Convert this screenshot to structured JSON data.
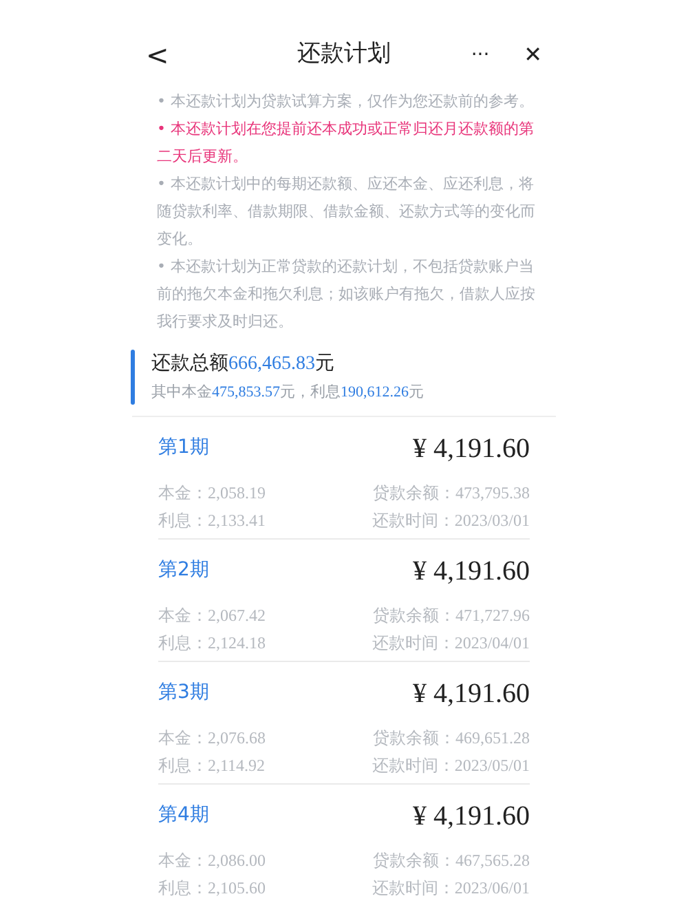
{
  "header": {
    "back": "<",
    "title": "还款计划",
    "more": "···",
    "close": "✕"
  },
  "notes": [
    {
      "text": "• 本还款计划为贷款试算方案，仅作为您还款前的参考。",
      "kind": "normal"
    },
    {
      "text": "• 本还款计划在您提前还本成功或正常归还月还款额的第二天后更新。",
      "kind": "highlight"
    },
    {
      "text": "• 本还款计划中的每期还款额、应还本金、应还利息，将随贷款利率、借款期限、借款金额、还款方式等的变化而变化。",
      "kind": "normal"
    },
    {
      "text": "• 本还款计划为正常贷款的还款计划，不包括贷款账户当前的拖欠本金和拖欠利息；如该账户有拖欠，借款人应按我行要求及时归还。",
      "kind": "normal"
    }
  ],
  "summary": {
    "total": [
      {
        "text": "还款总额",
        "kind": "label"
      },
      {
        "text": "666,465.83",
        "kind": "number"
      },
      {
        "text": "元",
        "kind": "label"
      }
    ],
    "breakdown": [
      {
        "text": "其中本金",
        "kind": "label"
      },
      {
        "text": "475,853.57",
        "kind": "number"
      },
      {
        "text": "元，利息",
        "kind": "label"
      },
      {
        "text": "190,612.26",
        "kind": "number"
      },
      {
        "text": "元",
        "kind": "label"
      }
    ]
  },
  "periods": [
    {
      "name": "第1期",
      "amount": "¥ 4,191.60",
      "principal_label": "本金：",
      "principal": "2,058.19",
      "balance_label": "贷款余额：",
      "balance": "473,795.38",
      "interest_label": "利息：",
      "interest": "2,133.41",
      "date_label": "还款时间：",
      "date": "2023/03/01"
    },
    {
      "name": "第2期",
      "amount": "¥ 4,191.60",
      "principal_label": "本金：",
      "principal": "2,067.42",
      "balance_label": "贷款余额：",
      "balance": "471,727.96",
      "interest_label": "利息：",
      "interest": "2,124.18",
      "date_label": "还款时间：",
      "date": "2023/04/01"
    },
    {
      "name": "第3期",
      "amount": "¥ 4,191.60",
      "principal_label": "本金：",
      "principal": "2,076.68",
      "balance_label": "贷款余额：",
      "balance": "469,651.28",
      "interest_label": "利息：",
      "interest": "2,114.92",
      "date_label": "还款时间：",
      "date": "2023/05/01"
    },
    {
      "name": "第4期",
      "amount": "¥ 4,191.60",
      "principal_label": "本金：",
      "principal": "2,086.00",
      "balance_label": "贷款余额：",
      "balance": "467,565.28",
      "interest_label": "利息：",
      "interest": "2,105.60",
      "date_label": "还款时间：",
      "date": "2023/06/01"
    }
  ]
}
